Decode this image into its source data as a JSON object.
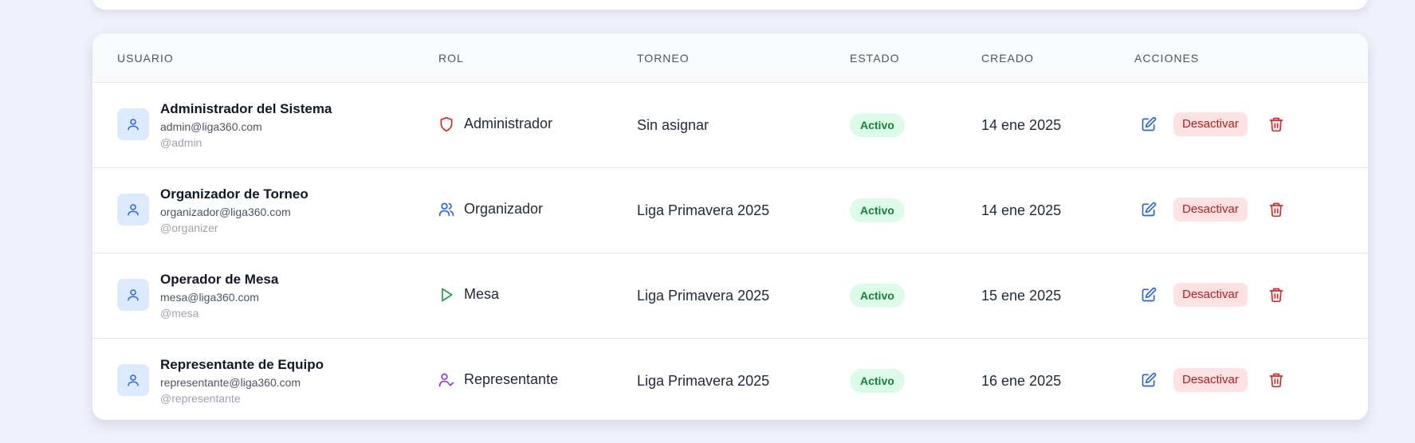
{
  "table": {
    "headers": {
      "usuario": "USUARIO",
      "rol": "ROL",
      "torneo": "TORNEO",
      "estado": "ESTADO",
      "creado": "CREADO",
      "acciones": "ACCIONES"
    },
    "rows": [
      {
        "name": "Administrador del Sistema",
        "email": "admin@liga360.com",
        "handle": "@admin",
        "role": "Administrador",
        "role_icon": "shield-icon",
        "role_color": "#dc2626",
        "torneo": "Sin asignar",
        "estado": "Activo",
        "creado": "14 ene 2025",
        "deactivate_label": "Desactivar"
      },
      {
        "name": "Organizador de Torneo",
        "email": "organizador@liga360.com",
        "handle": "@organizer",
        "role": "Organizador",
        "role_icon": "users-icon",
        "role_color": "#2563eb",
        "torneo": "Liga Primavera 2025",
        "estado": "Activo",
        "creado": "14 ene 2025",
        "deactivate_label": "Desactivar"
      },
      {
        "name": "Operador de Mesa",
        "email": "mesa@liga360.com",
        "handle": "@mesa",
        "role": "Mesa",
        "role_icon": "play-icon",
        "role_color": "#16a34a",
        "torneo": "Liga Primavera 2025",
        "estado": "Activo",
        "creado": "15 ene 2025",
        "deactivate_label": "Desactivar"
      },
      {
        "name": "Representante de Equipo",
        "email": "representante@liga360.com",
        "handle": "@representante",
        "role": "Representante",
        "role_icon": "user-check-icon",
        "role_color": "#9333ea",
        "torneo": "Liga Primavera 2025",
        "estado": "Activo",
        "creado": "16 ene 2025",
        "deactivate_label": "Desactivar"
      }
    ]
  },
  "colors": {
    "accent": "#2563eb",
    "danger": "#dc2626",
    "success_bg": "#dcfce7",
    "success_text": "#15803d"
  }
}
